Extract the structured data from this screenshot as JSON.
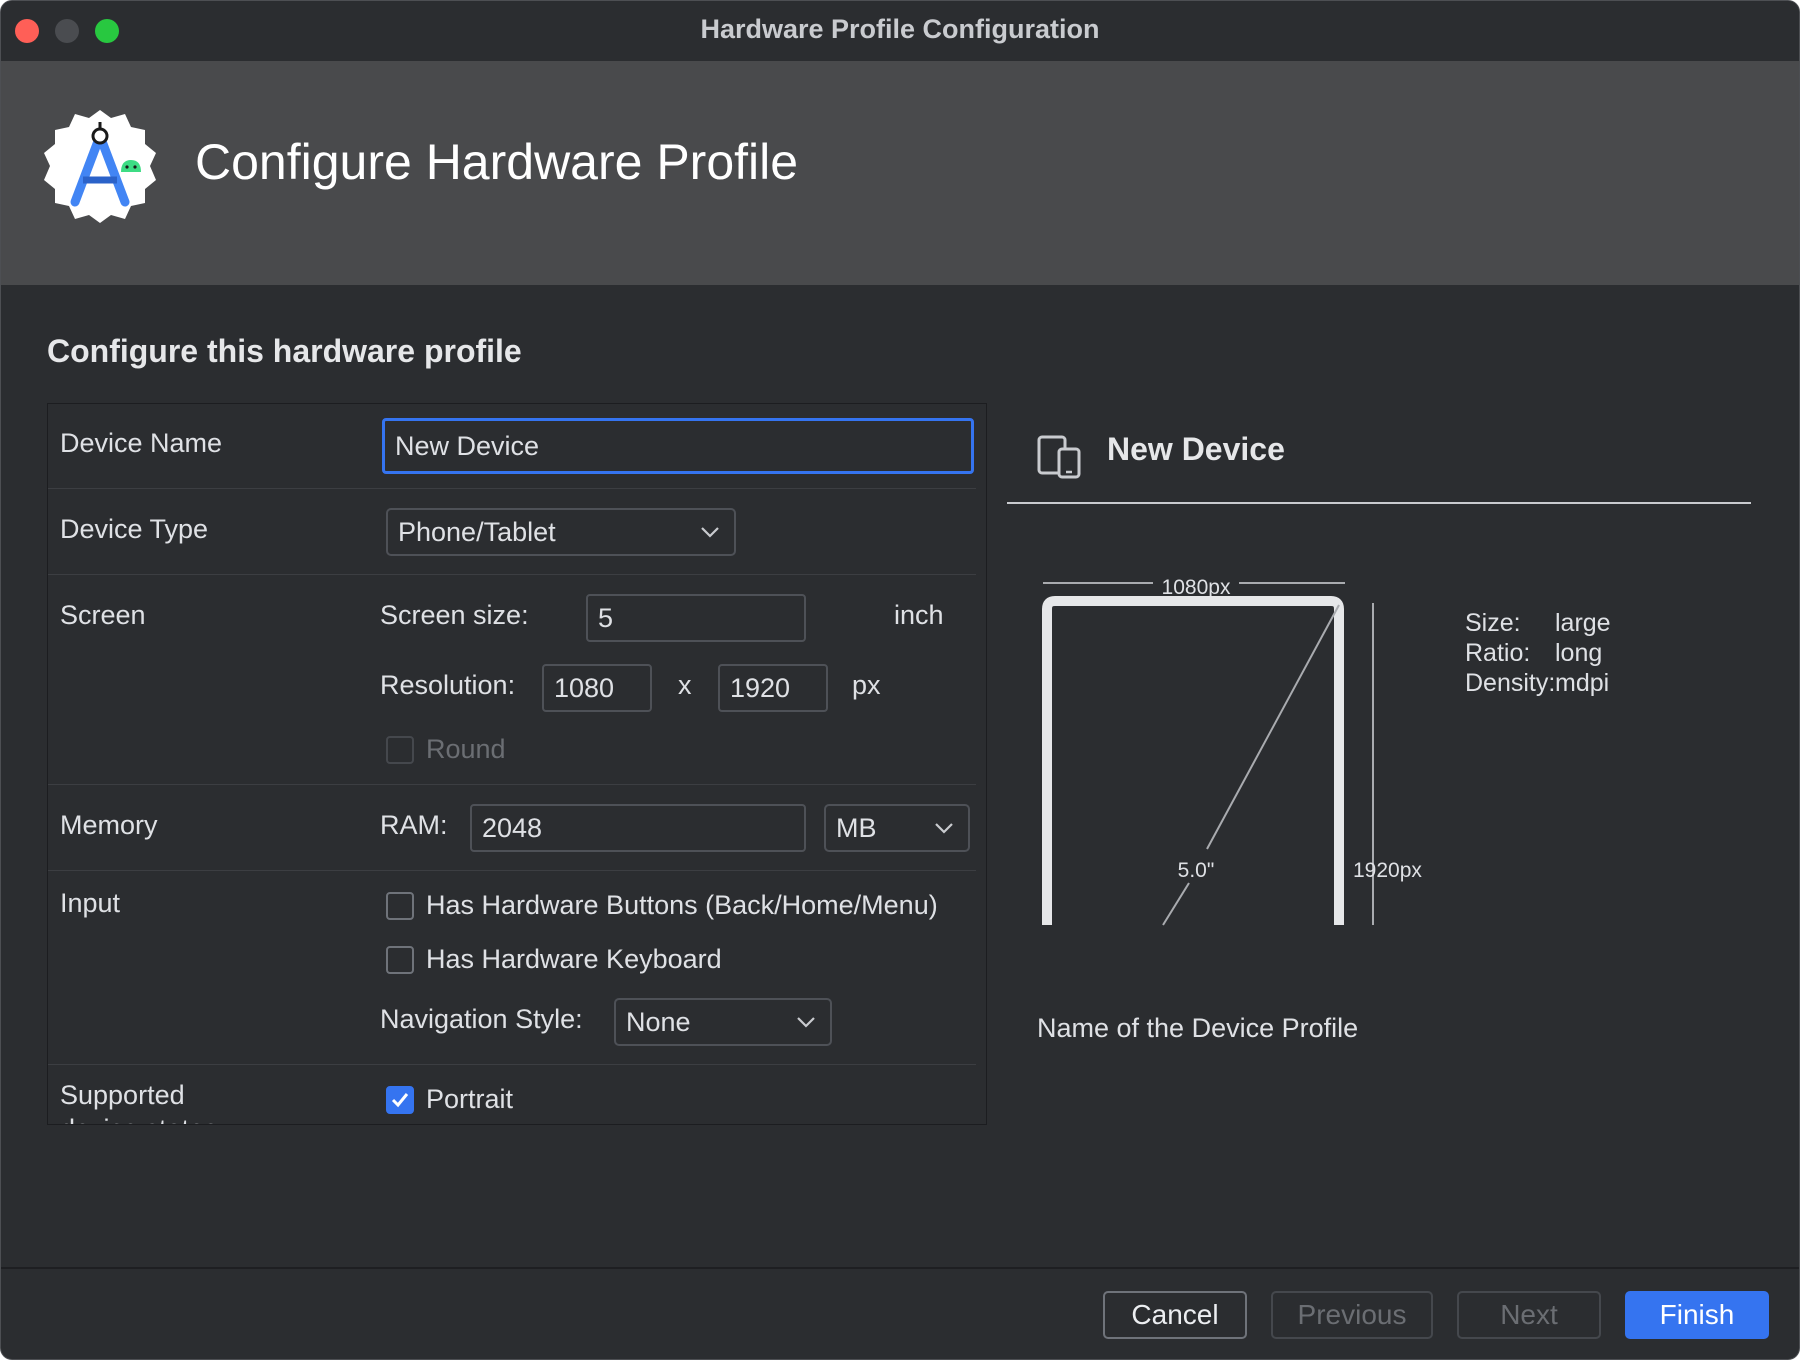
{
  "window": {
    "title": "Hardware Profile Configuration"
  },
  "header": {
    "title": "Configure Hardware Profile",
    "logo_icon": "android-studio-logo"
  },
  "form": {
    "section_title": "Configure this hardware profile",
    "device_name": {
      "label": "Device Name",
      "value": "New Device"
    },
    "device_type": {
      "label": "Device Type",
      "value": "Phone/Tablet"
    },
    "screen": {
      "label": "Screen",
      "size_label": "Screen size:",
      "size_value": "5",
      "size_unit": "inch",
      "resolution_label": "Resolution:",
      "res_width": "1080",
      "res_separator": "x",
      "res_height": "1920",
      "res_unit": "px",
      "round_label": "Round",
      "round_checked": false
    },
    "memory": {
      "label": "Memory",
      "ram_label": "RAM:",
      "ram_value": "2048",
      "ram_unit": "MB"
    },
    "input": {
      "label": "Input",
      "hw_buttons_label": "Has Hardware Buttons (Back/Home/Menu)",
      "hw_buttons_checked": false,
      "hw_keyboard_label": "Has Hardware Keyboard",
      "hw_keyboard_checked": false,
      "nav_style_label": "Navigation Style:",
      "nav_style_value": "None"
    },
    "device_states": {
      "label": "Supported device states",
      "portrait_label": "Portrait",
      "portrait_checked": true
    }
  },
  "preview": {
    "title": "New Device",
    "device_icon": "phone-tablet-icon",
    "width_label": "1080px",
    "height_label": "1920px",
    "diagonal_label": "5.0\"",
    "info": [
      {
        "key": "Size:",
        "value": "large"
      },
      {
        "key": "Ratio:",
        "value": "long"
      },
      {
        "key": "Density:",
        "value": "mdpi"
      }
    ],
    "description": "Name of the Device Profile"
  },
  "buttons": {
    "cancel": "Cancel",
    "previous": "Previous",
    "next": "Next",
    "finish": "Finish"
  },
  "colors": {
    "accent": "#3574f0",
    "background": "#2b2d30",
    "header": "#494a4c"
  }
}
